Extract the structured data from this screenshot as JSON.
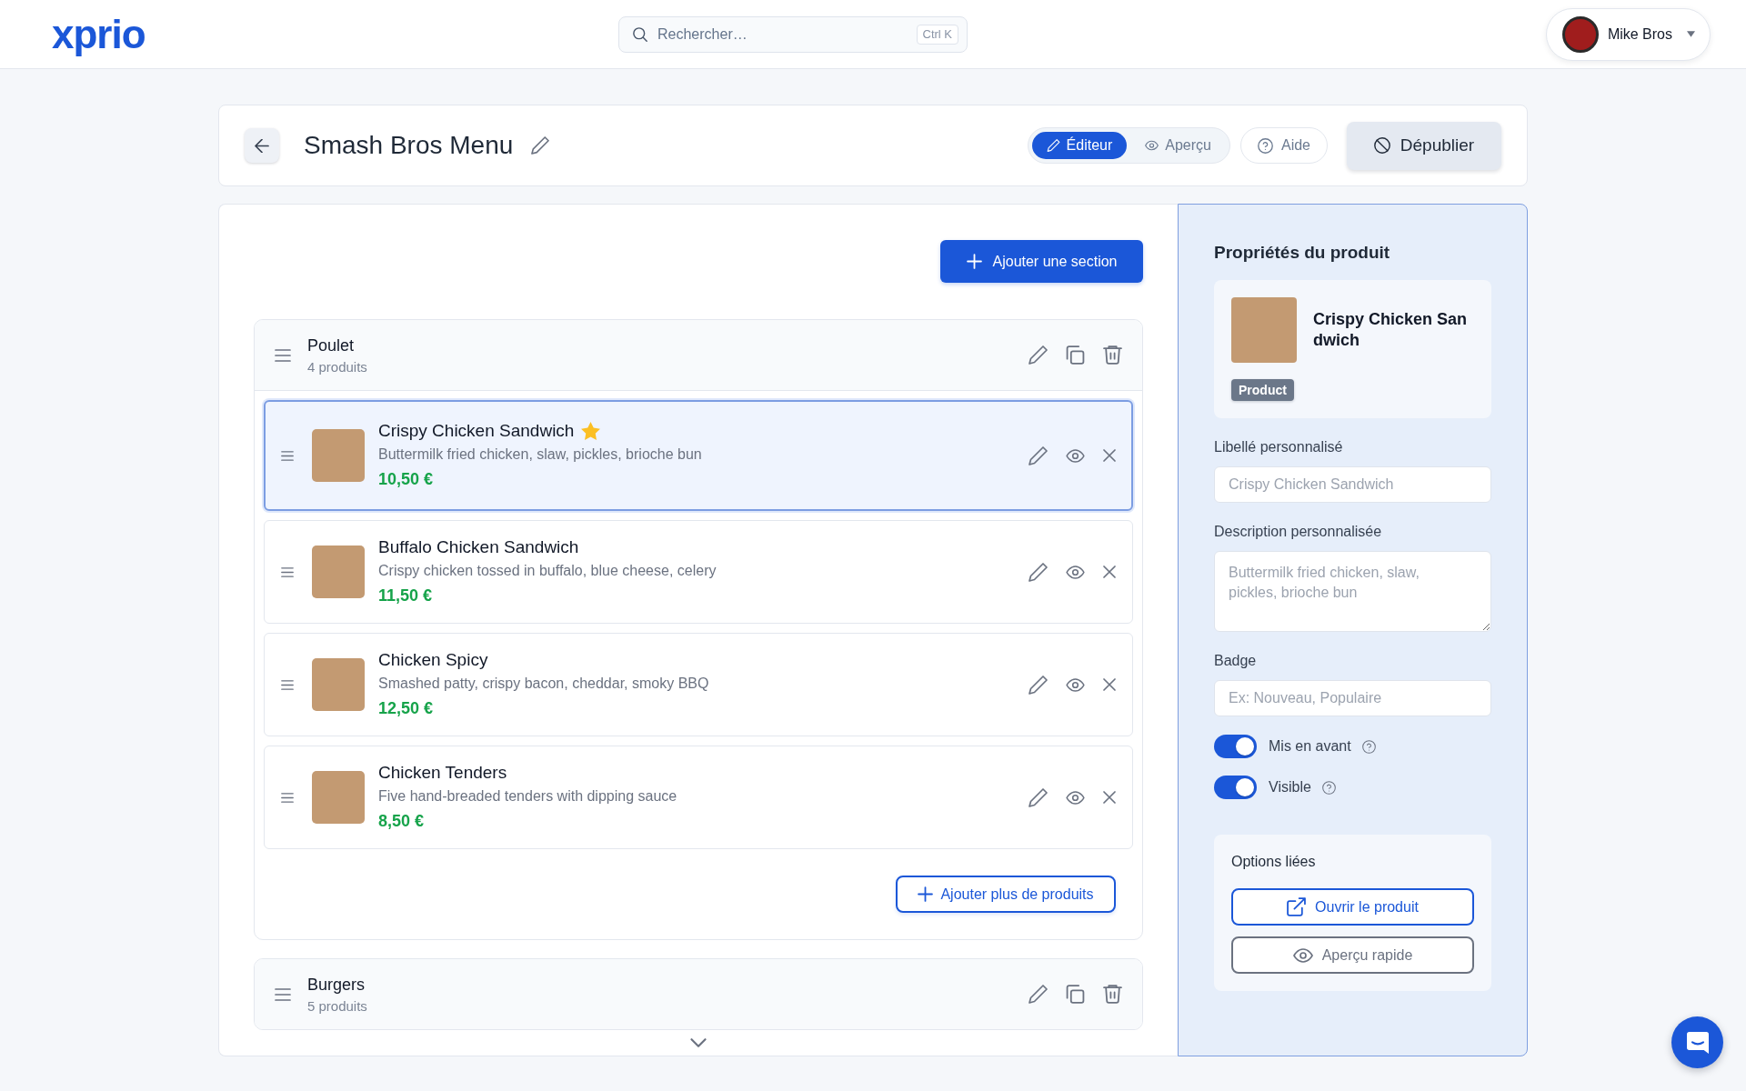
{
  "header": {
    "logo": "xprio",
    "search": {
      "placeholder": "Rechercher…",
      "shortcut": "Ctrl K"
    },
    "user": {
      "name": "Mike Bros"
    }
  },
  "toolbar": {
    "title": "Smash Bros Menu",
    "modes": [
      {
        "kind": "edit",
        "label": "Éditeur",
        "selected": true
      },
      {
        "kind": "preview",
        "label": "Aperçu",
        "selected": false
      }
    ],
    "help_label": "Aide",
    "unpublish_label": "Dépublier"
  },
  "editor": {
    "add_section_label": "Ajouter une section",
    "sections": [
      {
        "name": "Poulet",
        "count": "4 produits",
        "items": [
          {
            "name": "Crispy Chicken Sandwich",
            "description": "Buttermilk fried chicken, slaw, pickles, brioche bun",
            "price": "10,50 €",
            "selected": true,
            "featured": true
          },
          {
            "name": "Buffalo Chicken Sandwich",
            "description": "Crispy chicken tossed in buffalo, blue cheese, celery",
            "price": "11,50 €",
            "selected": false,
            "featured": false
          },
          {
            "name": "Chicken Spicy",
            "description": "Smashed patty, crispy bacon, cheddar, smoky BBQ",
            "price": "12,50 €",
            "selected": false,
            "featured": false
          },
          {
            "name": "Chicken Tenders",
            "description": "Five hand-breaded tenders with dipping sauce",
            "price": "8,50 €",
            "selected": false,
            "featured": false
          }
        ],
        "add_products_label": "Ajouter plus de produits"
      },
      {
        "name": "Burgers",
        "count": "5 produits"
      }
    ]
  },
  "properties": {
    "title": "Propriétés du produit",
    "product": {
      "name": "Crispy Chicken Sandwich",
      "type_badge": "Product"
    },
    "fields": [
      {
        "kind": "input",
        "label": "Libellé personnalisé",
        "placeholder": "Crispy Chicken Sandwich"
      },
      {
        "kind": "textarea",
        "label": "Description personnalisée",
        "placeholder": "Buttermilk fried chicken, slaw, pickles, brioche bun"
      },
      {
        "kind": "input",
        "label": "Badge",
        "placeholder": "Ex: Nouveau, Populaire"
      }
    ],
    "toggles": [
      {
        "label": "Mis en avant",
        "on": true
      },
      {
        "label": "Visible",
        "on": true
      }
    ],
    "linked_options": {
      "title": "Options liées",
      "buttons": [
        {
          "kind": "open",
          "label": "Ouvrir le produit"
        },
        {
          "kind": "preview",
          "label": "Aperçu rapide"
        }
      ]
    }
  }
}
